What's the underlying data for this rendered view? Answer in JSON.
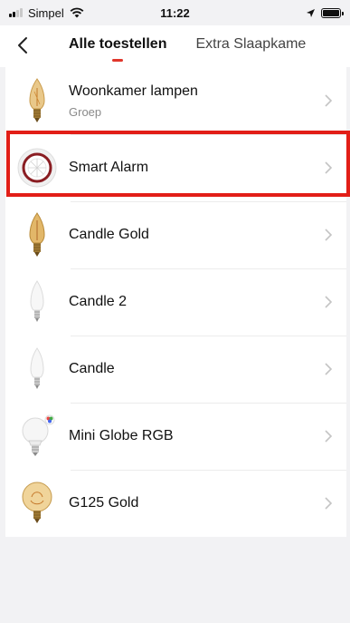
{
  "status_bar": {
    "carrier": "Simpel",
    "time": "11:22"
  },
  "header": {
    "tabs": [
      {
        "label": "Alle toestellen",
        "active": true
      },
      {
        "label": "Extra Slaapkame",
        "active": false
      }
    ]
  },
  "devices": [
    {
      "name": "Woonkamer lampen",
      "subtitle": "Groep",
      "icon": "filament-candle-bulb-icon"
    },
    {
      "name": "Smart Alarm",
      "subtitle": "",
      "icon": "smart-alarm-icon"
    },
    {
      "name": "Candle Gold",
      "subtitle": "",
      "icon": "gold-candle-bulb-icon"
    },
    {
      "name": "Candle 2",
      "subtitle": "",
      "icon": "white-candle-bulb-icon"
    },
    {
      "name": "Candle",
      "subtitle": "",
      "icon": "white-candle-bulb-icon"
    },
    {
      "name": "Mini Globe RGB",
      "subtitle": "",
      "icon": "mini-globe-rgb-bulb-icon"
    },
    {
      "name": "G125 Gold",
      "subtitle": "",
      "icon": "g125-gold-bulb-icon"
    }
  ],
  "colors": {
    "accent": "#e0362b",
    "highlight_box": "#e21e17",
    "background": "#f2f2f4",
    "list_background": "#ffffff"
  }
}
